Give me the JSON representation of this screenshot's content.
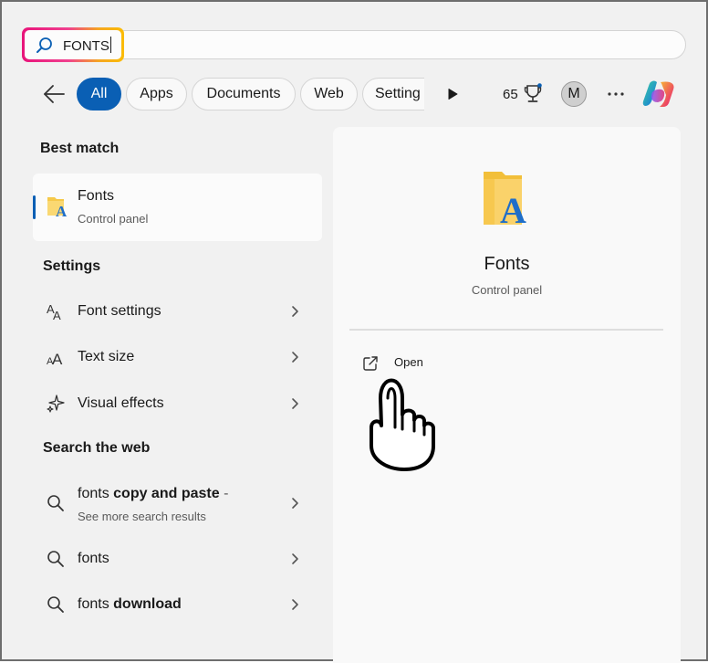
{
  "search": {
    "query": "FONTS",
    "icon": "search-icon"
  },
  "filters": {
    "back_icon": "back-arrow-icon",
    "chips": [
      {
        "label": "All",
        "active": true
      },
      {
        "label": "Apps",
        "active": false
      },
      {
        "label": "Documents",
        "active": false
      },
      {
        "label": "Web",
        "active": false
      },
      {
        "label": "Setting",
        "active": false
      }
    ],
    "more_filters_icon": "play-icon",
    "points": "65",
    "rewards_icon": "trophy-icon",
    "avatar_initial": "M",
    "more_icon": "more-icon",
    "copilot_icon": "copilot-icon"
  },
  "best_match": {
    "heading": "Best match",
    "item": {
      "name": "Fonts",
      "subtitle": "Control panel",
      "icon": "fonts-folder-icon"
    }
  },
  "settings": {
    "heading": "Settings",
    "items": [
      {
        "label": "Font settings",
        "icon": "font-settings-icon"
      },
      {
        "label": "Text size",
        "icon": "text-size-icon"
      },
      {
        "label": "Visual effects",
        "icon": "sparkle-icon"
      }
    ]
  },
  "web": {
    "heading": "Search the web",
    "items": [
      {
        "prefix": "fonts ",
        "bold": "copy and paste",
        "suffix": " -",
        "subtitle": "See more search results"
      },
      {
        "prefix": "fonts",
        "bold": "",
        "suffix": "",
        "subtitle": ""
      },
      {
        "prefix": "fonts ",
        "bold": "download",
        "suffix": "",
        "subtitle": ""
      }
    ]
  },
  "preview": {
    "title": "Fonts",
    "subtitle": "Control panel",
    "actions": [
      {
        "label": "Open",
        "icon": "open-external-icon"
      }
    ]
  },
  "colors": {
    "accent": "#0a5fb4",
    "highlight_gradient": [
      "#e8147a",
      "#f5a623"
    ]
  }
}
